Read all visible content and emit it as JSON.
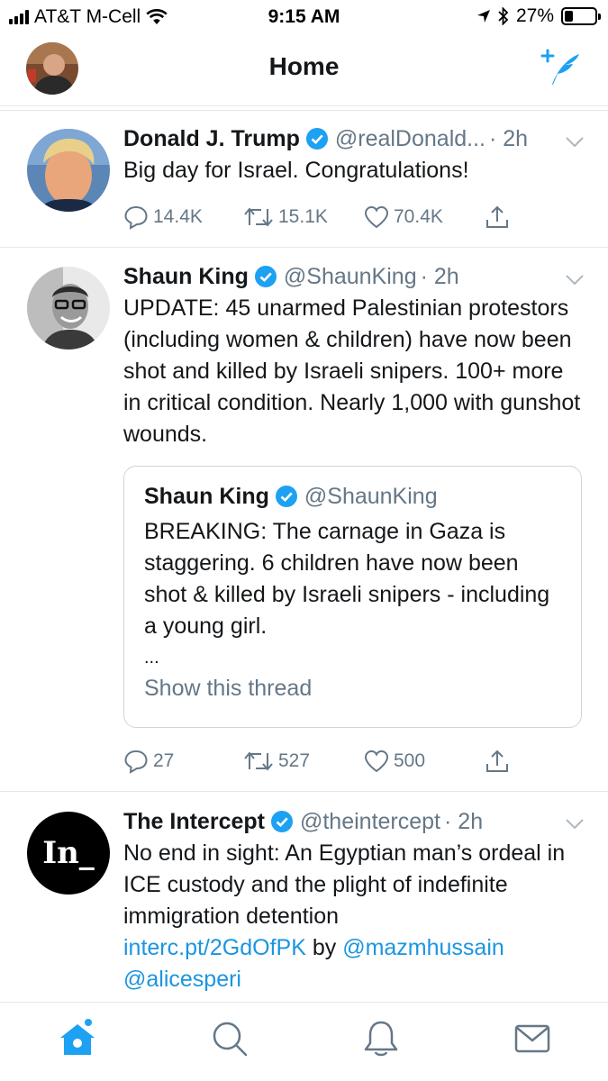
{
  "status_bar": {
    "carrier": "AT&T M-Cell",
    "time": "9:15 AM",
    "battery": "27%",
    "battery_level": 0.27,
    "icons": [
      "signal-icon",
      "wifi-icon",
      "location-arrow-icon",
      "bluetooth-icon",
      "battery-icon"
    ]
  },
  "header": {
    "title": "Home",
    "compose_icon": "compose-tweet-icon",
    "accent_color": "#1da1f2"
  },
  "tweets": [
    {
      "name": "Donald J. Trump",
      "handle": "@realDonald...",
      "time": "· 2h",
      "text": "Big day for Israel. Congratulations!",
      "replies": "14.4K",
      "retweets": "15.1K",
      "likes": "70.4K"
    },
    {
      "name": "Shaun King",
      "handle": "@ShaunKing",
      "time": "· 2h",
      "text": "UPDATE: 45 unarmed Palestinian protestors (including women & children) have now been shot and killed by Israeli snipers. 100+ more in critical condition. Nearly 1,000 with gunshot wounds.",
      "quote": {
        "name": "Shaun King",
        "handle": "@ShaunKing",
        "text": "BREAKING: The carnage in Gaza is staggering. 6 children have now been shot & killed by Israeli snipers - including a young girl.",
        "ellipsis": "...",
        "show_thread": "Show this thread"
      },
      "replies": "27",
      "retweets": "527",
      "likes": "500"
    },
    {
      "name": "The Intercept",
      "handle": "@theintercept",
      "time": "· 2h",
      "text": "No end in sight: An Egyptian man’s ordeal in ICE custody and the plight of indefinite immigration detention",
      "link": "interc.pt/2GdOfPK",
      "by": "by",
      "mention1": "@mazmhussain",
      "mention2": "@alicesperi",
      "avatar_text": "In_"
    }
  ],
  "tab_bar": {
    "tabs": [
      "home-icon",
      "search-icon",
      "notifications-icon",
      "messages-icon"
    ]
  }
}
